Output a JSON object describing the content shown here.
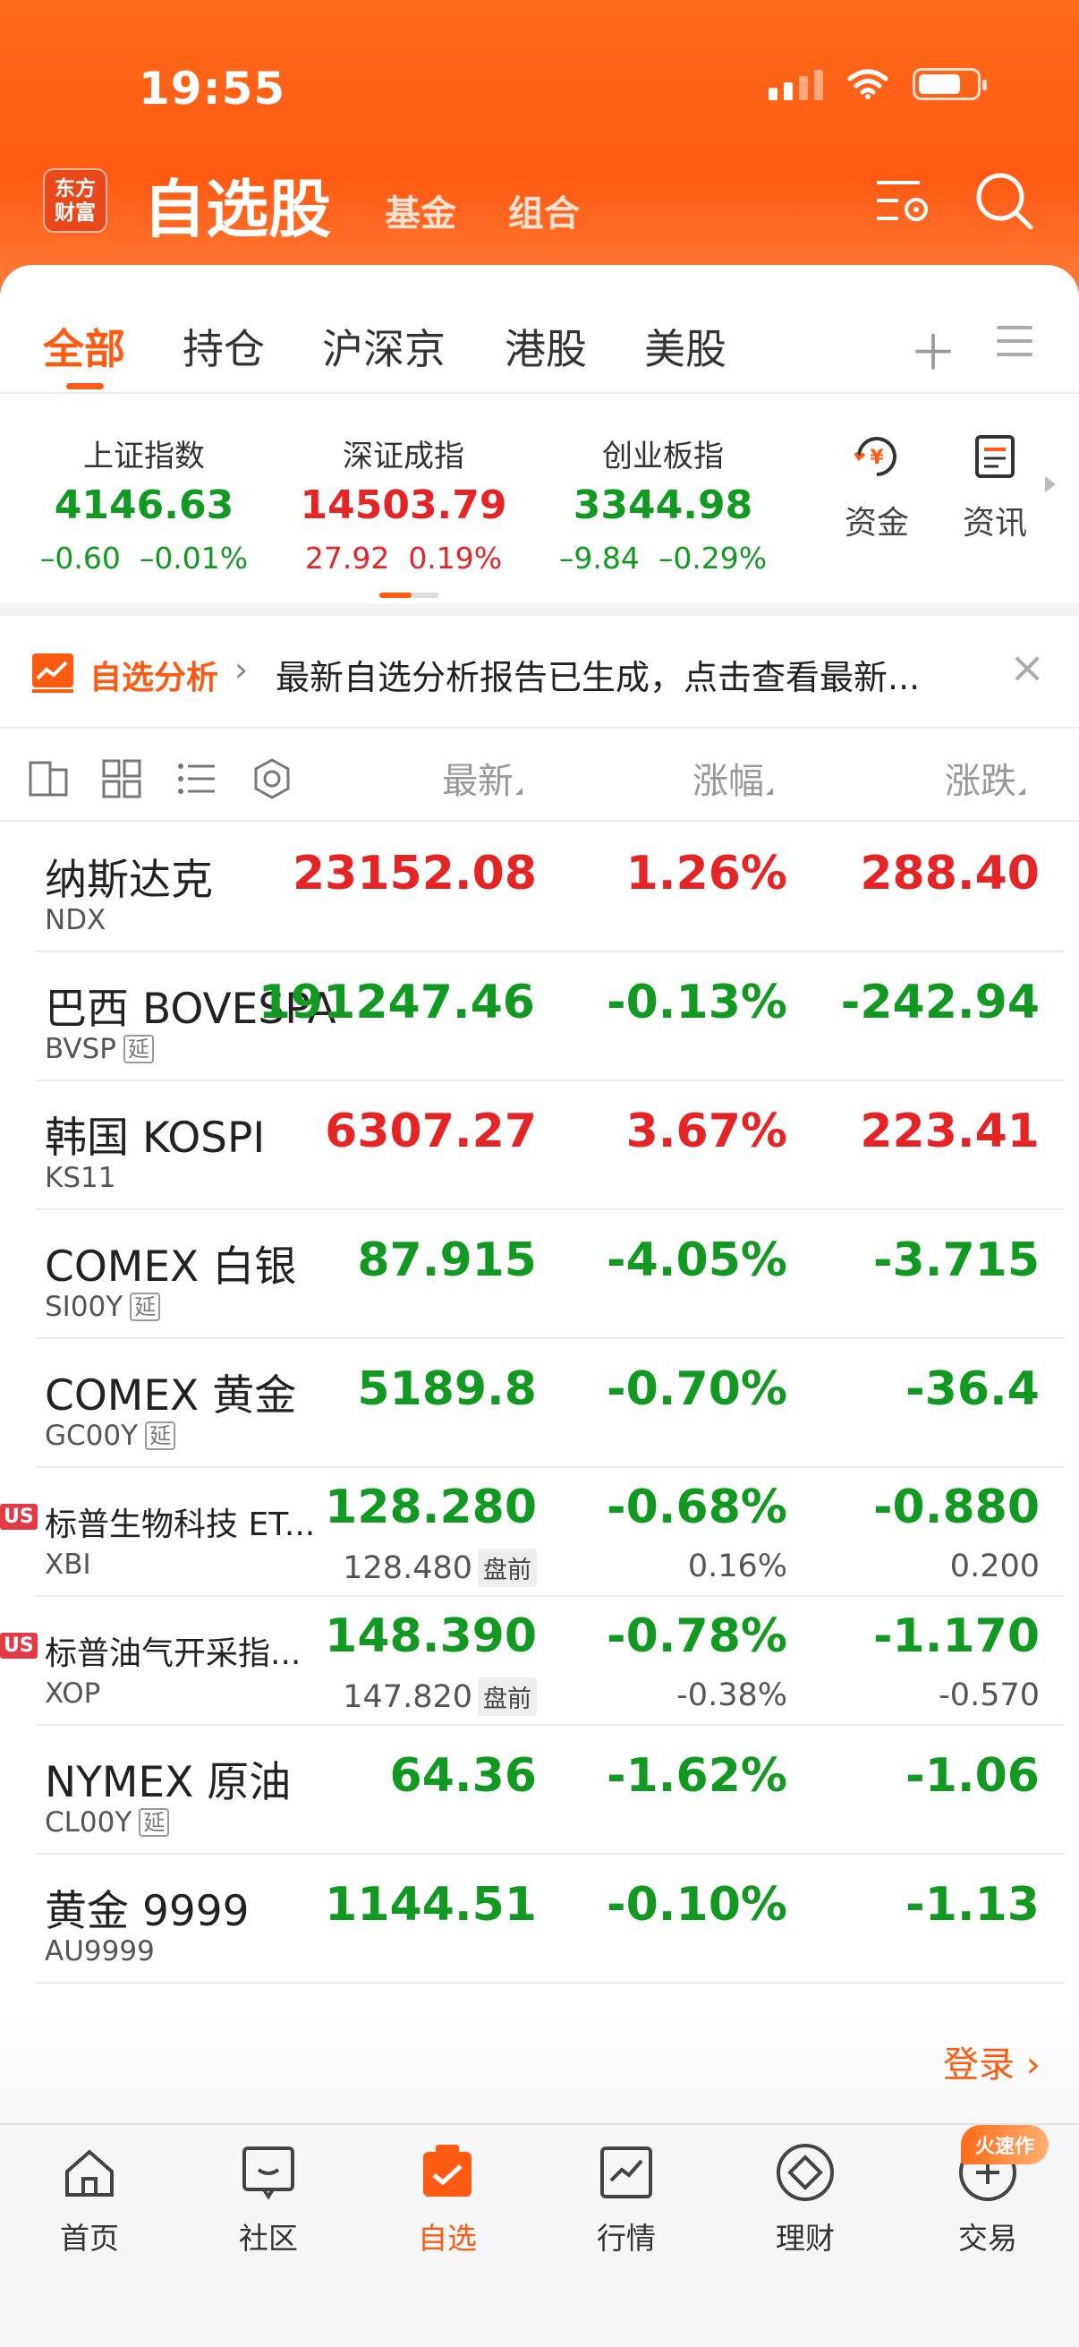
{
  "status": {
    "time": "19:55"
  },
  "header": {
    "logo_text_line1": "东方",
    "logo_text_line2": "财富",
    "title": "自选股",
    "subtabs": [
      "基金",
      "组合"
    ]
  },
  "tabs": {
    "items": [
      "全部",
      "持仓",
      "沪深京",
      "港股",
      "美股"
    ],
    "active": "全部"
  },
  "indices": [
    {
      "name": "上证指数",
      "price": "4146.63",
      "change": "–0.60",
      "pct": "–0.01%",
      "color": "#119922"
    },
    {
      "name": "深证成指",
      "price": "14503.79",
      "change": "27.92",
      "pct": "0.19%",
      "color": "#e52525"
    },
    {
      "name": "创业板指",
      "price": "3344.98",
      "change": "–9.84",
      "pct": "–0.29%",
      "color": "#119922"
    }
  ],
  "quick_links": {
    "funds": "资金",
    "news": "资讯"
  },
  "banner": {
    "tag": "自选分析",
    "text": "最新自选分析报告已生成，点击查看最新..."
  },
  "columns": {
    "latest": "最新",
    "change_pct": "涨幅",
    "change": "涨跌"
  },
  "rows": [
    {
      "name": "纳斯达克",
      "code": "NDX",
      "delayed": false,
      "price": "23152.08",
      "pct": "1.26%",
      "chg": "288.40",
      "color": "#e52525"
    },
    {
      "name": "巴西 BOVESPA",
      "code": "BVSP",
      "delayed": true,
      "price": "191247.46",
      "pct": "-0.13%",
      "chg": "-242.94",
      "color": "#119922"
    },
    {
      "name": "韩国 KOSPI",
      "code": "KS11",
      "delayed": false,
      "price": "6307.27",
      "pct": "3.67%",
      "chg": "223.41",
      "color": "#e52525"
    },
    {
      "name": "COMEX 白银",
      "code": "SI00Y",
      "delayed": true,
      "price": "87.915",
      "pct": "-4.05%",
      "chg": "-3.715",
      "color": "#119922"
    },
    {
      "name": "COMEX 黄金",
      "code": "GC00Y",
      "delayed": true,
      "price": "5189.8",
      "pct": "-0.70%",
      "chg": "-36.4",
      "color": "#119922"
    },
    {
      "name": "标普生物科技 ET...",
      "code": "XBI",
      "us": true,
      "price": "128.280",
      "pct": "-0.68%",
      "chg": "-0.880",
      "color": "#119922",
      "pre_price": "128.480",
      "pre_label": "盘前",
      "pre_pct": "0.16%",
      "pre_chg": "0.200"
    },
    {
      "name": "标普油气开采指...",
      "code": "XOP",
      "us": true,
      "price": "148.390",
      "pct": "-0.78%",
      "chg": "-1.170",
      "color": "#119922",
      "pre_price": "147.820",
      "pre_label": "盘前",
      "pre_pct": "-0.38%",
      "pre_chg": "-0.570"
    },
    {
      "name": "NYMEX 原油",
      "code": "CL00Y",
      "delayed": true,
      "price": "64.36",
      "pct": "-1.62%",
      "chg": "-1.06",
      "color": "#119922"
    },
    {
      "name": "黄金 9999",
      "code": "AU9999",
      "delayed": false,
      "price": "1144.51",
      "pct": "-0.10%",
      "chg": "-1.13",
      "color": "#119922"
    }
  ],
  "delay_label": "延",
  "us_label": "US",
  "login": "登录",
  "tabbar": {
    "items": [
      "首页",
      "社区",
      "自选",
      "行情",
      "理财",
      "交易"
    ],
    "active": "自选",
    "promo": "火速作"
  }
}
